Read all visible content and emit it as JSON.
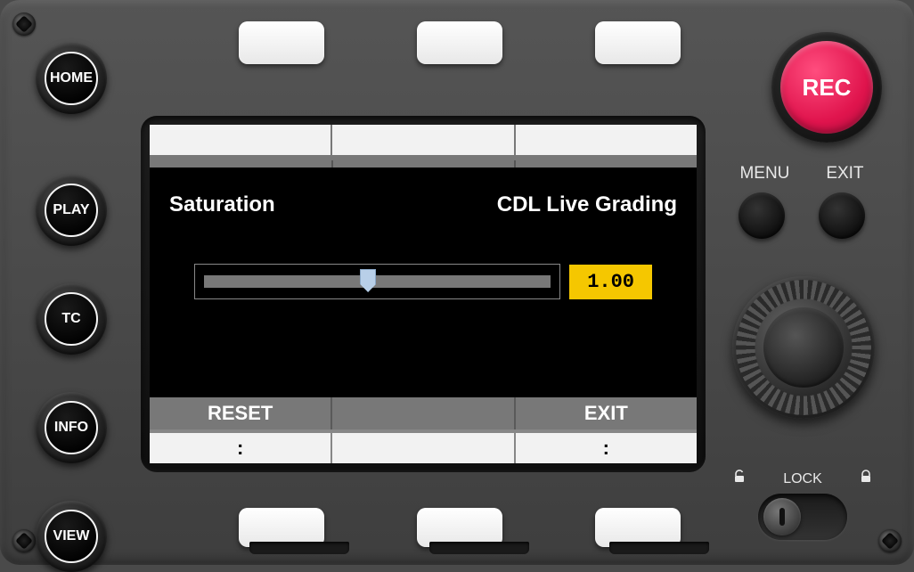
{
  "left_buttons": {
    "home": "HOME",
    "play": "PLAY",
    "tc": "TC",
    "info": "INFO",
    "view": "VIEW"
  },
  "rec_label": "REC",
  "right_labels": {
    "menu": "MENU",
    "exit": "EXIT"
  },
  "lock": {
    "label": "LOCK",
    "unlock_icon": "🔓",
    "lock_icon": "🔒"
  },
  "screen": {
    "param_label": "Saturation",
    "context_label": "CDL Live Grading",
    "value": "1.00",
    "actions": {
      "reset": "RESET",
      "exit": "EXIT"
    },
    "colons": {
      "left": ":",
      "right": ":"
    }
  },
  "colors": {
    "accent_yellow": "#f5c700",
    "rec_red": "#e0144d"
  }
}
